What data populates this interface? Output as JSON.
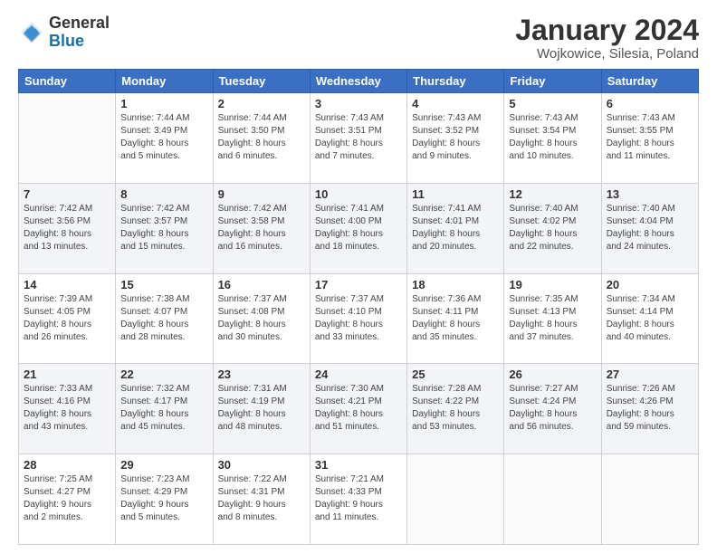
{
  "logo": {
    "general": "General",
    "blue": "Blue"
  },
  "header": {
    "title": "January 2024",
    "subtitle": "Wojkowice, Silesia, Poland"
  },
  "days_of_week": [
    "Sunday",
    "Monday",
    "Tuesday",
    "Wednesday",
    "Thursday",
    "Friday",
    "Saturday"
  ],
  "weeks": [
    [
      {
        "day": "",
        "info": ""
      },
      {
        "day": "1",
        "info": "Sunrise: 7:44 AM\nSunset: 3:49 PM\nDaylight: 8 hours\nand 5 minutes."
      },
      {
        "day": "2",
        "info": "Sunrise: 7:44 AM\nSunset: 3:50 PM\nDaylight: 8 hours\nand 6 minutes."
      },
      {
        "day": "3",
        "info": "Sunrise: 7:43 AM\nSunset: 3:51 PM\nDaylight: 8 hours\nand 7 minutes."
      },
      {
        "day": "4",
        "info": "Sunrise: 7:43 AM\nSunset: 3:52 PM\nDaylight: 8 hours\nand 9 minutes."
      },
      {
        "day": "5",
        "info": "Sunrise: 7:43 AM\nSunset: 3:54 PM\nDaylight: 8 hours\nand 10 minutes."
      },
      {
        "day": "6",
        "info": "Sunrise: 7:43 AM\nSunset: 3:55 PM\nDaylight: 8 hours\nand 11 minutes."
      }
    ],
    [
      {
        "day": "7",
        "info": "Sunrise: 7:42 AM\nSunset: 3:56 PM\nDaylight: 8 hours\nand 13 minutes."
      },
      {
        "day": "8",
        "info": "Sunrise: 7:42 AM\nSunset: 3:57 PM\nDaylight: 8 hours\nand 15 minutes."
      },
      {
        "day": "9",
        "info": "Sunrise: 7:42 AM\nSunset: 3:58 PM\nDaylight: 8 hours\nand 16 minutes."
      },
      {
        "day": "10",
        "info": "Sunrise: 7:41 AM\nSunset: 4:00 PM\nDaylight: 8 hours\nand 18 minutes."
      },
      {
        "day": "11",
        "info": "Sunrise: 7:41 AM\nSunset: 4:01 PM\nDaylight: 8 hours\nand 20 minutes."
      },
      {
        "day": "12",
        "info": "Sunrise: 7:40 AM\nSunset: 4:02 PM\nDaylight: 8 hours\nand 22 minutes."
      },
      {
        "day": "13",
        "info": "Sunrise: 7:40 AM\nSunset: 4:04 PM\nDaylight: 8 hours\nand 24 minutes."
      }
    ],
    [
      {
        "day": "14",
        "info": "Sunrise: 7:39 AM\nSunset: 4:05 PM\nDaylight: 8 hours\nand 26 minutes."
      },
      {
        "day": "15",
        "info": "Sunrise: 7:38 AM\nSunset: 4:07 PM\nDaylight: 8 hours\nand 28 minutes."
      },
      {
        "day": "16",
        "info": "Sunrise: 7:37 AM\nSunset: 4:08 PM\nDaylight: 8 hours\nand 30 minutes."
      },
      {
        "day": "17",
        "info": "Sunrise: 7:37 AM\nSunset: 4:10 PM\nDaylight: 8 hours\nand 33 minutes."
      },
      {
        "day": "18",
        "info": "Sunrise: 7:36 AM\nSunset: 4:11 PM\nDaylight: 8 hours\nand 35 minutes."
      },
      {
        "day": "19",
        "info": "Sunrise: 7:35 AM\nSunset: 4:13 PM\nDaylight: 8 hours\nand 37 minutes."
      },
      {
        "day": "20",
        "info": "Sunrise: 7:34 AM\nSunset: 4:14 PM\nDaylight: 8 hours\nand 40 minutes."
      }
    ],
    [
      {
        "day": "21",
        "info": "Sunrise: 7:33 AM\nSunset: 4:16 PM\nDaylight: 8 hours\nand 43 minutes."
      },
      {
        "day": "22",
        "info": "Sunrise: 7:32 AM\nSunset: 4:17 PM\nDaylight: 8 hours\nand 45 minutes."
      },
      {
        "day": "23",
        "info": "Sunrise: 7:31 AM\nSunset: 4:19 PM\nDaylight: 8 hours\nand 48 minutes."
      },
      {
        "day": "24",
        "info": "Sunrise: 7:30 AM\nSunset: 4:21 PM\nDaylight: 8 hours\nand 51 minutes."
      },
      {
        "day": "25",
        "info": "Sunrise: 7:28 AM\nSunset: 4:22 PM\nDaylight: 8 hours\nand 53 minutes."
      },
      {
        "day": "26",
        "info": "Sunrise: 7:27 AM\nSunset: 4:24 PM\nDaylight: 8 hours\nand 56 minutes."
      },
      {
        "day": "27",
        "info": "Sunrise: 7:26 AM\nSunset: 4:26 PM\nDaylight: 8 hours\nand 59 minutes."
      }
    ],
    [
      {
        "day": "28",
        "info": "Sunrise: 7:25 AM\nSunset: 4:27 PM\nDaylight: 9 hours\nand 2 minutes."
      },
      {
        "day": "29",
        "info": "Sunrise: 7:23 AM\nSunset: 4:29 PM\nDaylight: 9 hours\nand 5 minutes."
      },
      {
        "day": "30",
        "info": "Sunrise: 7:22 AM\nSunset: 4:31 PM\nDaylight: 9 hours\nand 8 minutes."
      },
      {
        "day": "31",
        "info": "Sunrise: 7:21 AM\nSunset: 4:33 PM\nDaylight: 9 hours\nand 11 minutes."
      },
      {
        "day": "",
        "info": ""
      },
      {
        "day": "",
        "info": ""
      },
      {
        "day": "",
        "info": ""
      }
    ]
  ]
}
